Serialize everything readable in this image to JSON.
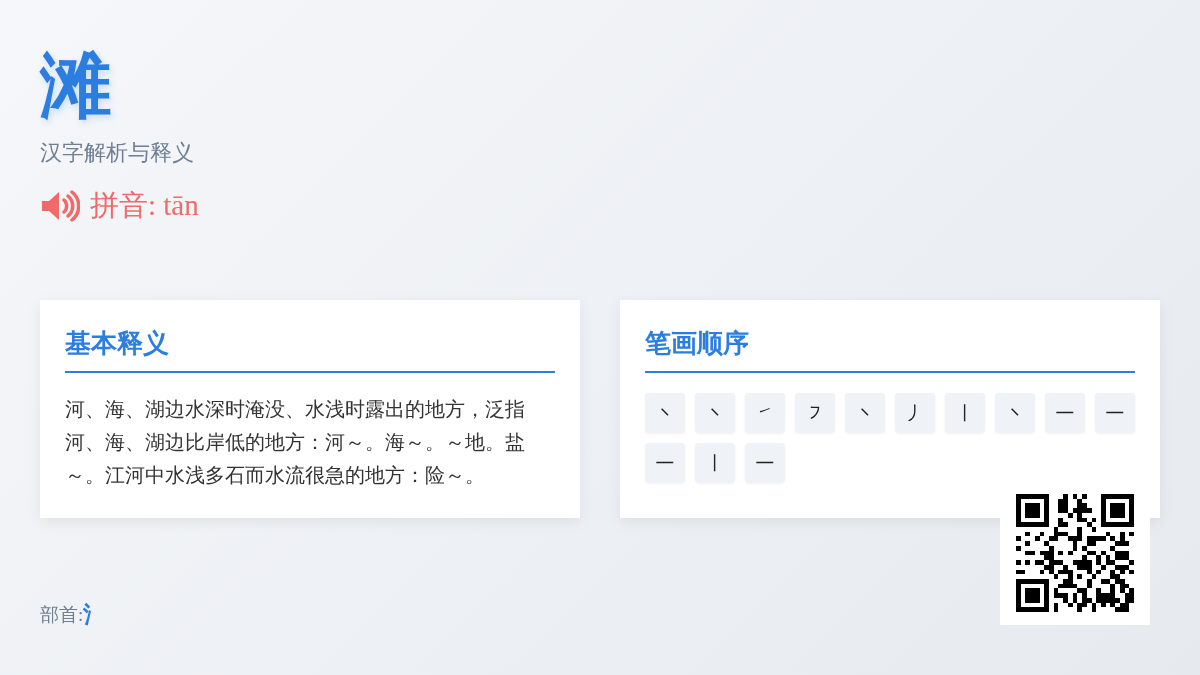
{
  "character": "滩",
  "subtitle": "汉字解析与释义",
  "pinyin": {
    "label": "拼音: tān"
  },
  "definition": {
    "title": "基本释义",
    "text": "河、海、湖边水深时淹没、水浅时露出的地方，泛指河、海、湖边比岸低的地方：河～。海～。～地。盐～。江河中水浅多石而水流很急的地方：险～。"
  },
  "strokes": {
    "title": "笔画顺序",
    "items": [
      "㇔",
      "㇔",
      "㇀",
      "㇇",
      "㇔",
      "㇓",
      "㇑",
      "㇔",
      "㇐",
      "㇐",
      "㇐",
      "㇑",
      "㇐"
    ]
  },
  "radical": {
    "label": "部首: ",
    "value": "氵"
  }
}
